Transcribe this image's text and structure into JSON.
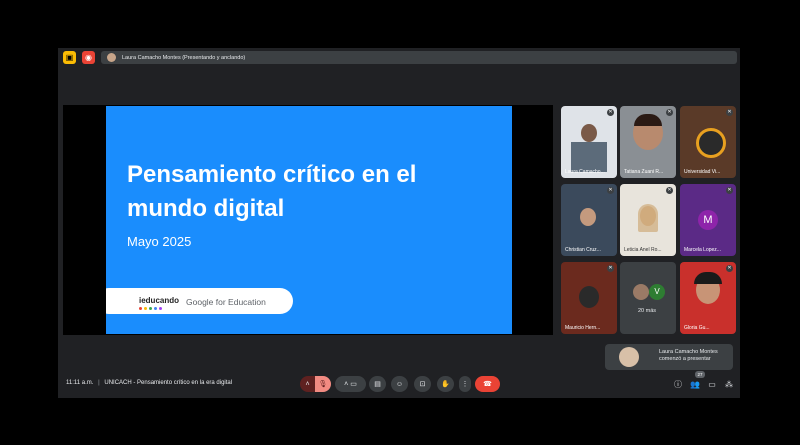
{
  "top_bar": {
    "presenter_text": "Laura Camacho Montes (Presentando y anclando)"
  },
  "slide": {
    "title": "Pensamiento crítico en el mundo digital",
    "date": "Mayo 2025",
    "brand_left": "ieducando",
    "brand_right": "Google for Education"
  },
  "participants": [
    {
      "name": "Laura Camacho..."
    },
    {
      "name": "Tatiana Zuani R..."
    },
    {
      "name": "Universidad Vi..."
    },
    {
      "name": "Christian Cruz..."
    },
    {
      "name": "Leticia Anel Ro..."
    },
    {
      "name": "Marcela Lopez...",
      "initial": "M"
    },
    {
      "name": "Mauricio Hern..."
    },
    {
      "name": "20 más",
      "initial": "V"
    },
    {
      "name": "Gloria Gu..."
    }
  ],
  "toast": {
    "line1": "Laura Camacho Montes",
    "line2": "comenzó a presentar"
  },
  "footer": {
    "time": "11:11 a.m.",
    "separator": "|",
    "meeting_title": "UNICACH - Pensamiento crítico en la era digital",
    "people_count": "27"
  },
  "colors": {
    "slide_bg": "#1a8dfd",
    "end_call": "#ea4335",
    "mic_off": "#f28b82"
  }
}
